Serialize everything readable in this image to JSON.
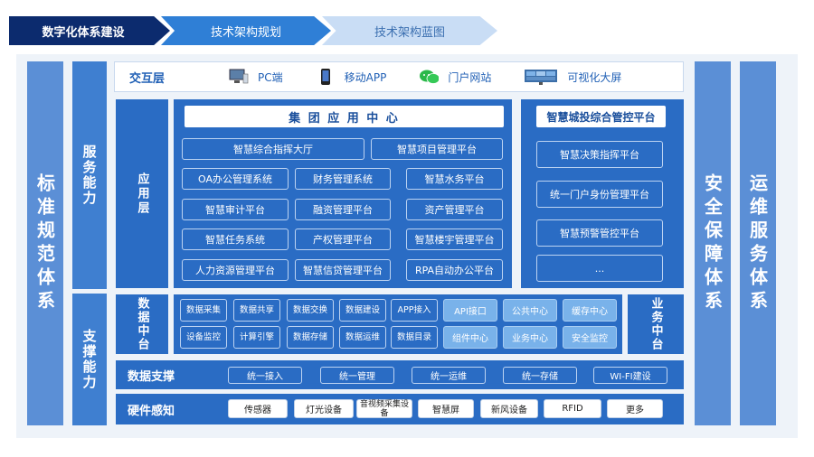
{
  "steps": [
    "数字化体系建设",
    "技术架构规划",
    "技术架构蓝图"
  ],
  "left_columns": {
    "standards": "标准规范体系",
    "service_capability": "服务能力",
    "support_capability": "支撑能力"
  },
  "right_columns": {
    "security": "安全保障体系",
    "ops": "运维服务体系"
  },
  "interaction_layer": {
    "title": "交互层",
    "items": [
      {
        "label": "PC端",
        "icon": "desktop-icon"
      },
      {
        "label": "移动APP",
        "icon": "mobile-phone-icon"
      },
      {
        "label": "门户网站",
        "icon": "wechat-icon"
      },
      {
        "label": "可视化大屏",
        "icon": "big-screen-icon"
      }
    ]
  },
  "application_layer": {
    "title": "应用层",
    "group_center": {
      "title": "集 团 应 用 中 心",
      "rows": [
        [
          "智慧综合指挥大厅",
          "智慧项目管理平台"
        ],
        [
          "OA办公管理系统",
          "财务管理系统",
          "智慧水务平台"
        ],
        [
          "智慧审计平台",
          "融资管理平台",
          "资产管理平台"
        ],
        [
          "智慧任务系统",
          "产权管理平台",
          "智慧楼宇管理平台"
        ],
        [
          "人力资源管理平台",
          "智慧信贷管理平台",
          "RPA自动办公平台"
        ]
      ]
    },
    "city_platform": {
      "title": "智慧城投综合管控平台",
      "items": [
        "智慧决策指挥平台",
        "统一门户身份管理平台",
        "智慧预警管控平台",
        "..."
      ]
    }
  },
  "data_middle": {
    "title": "数据中台",
    "row1": [
      "数据采集",
      "数据共享",
      "数据交换",
      "数据建设",
      "APP接入"
    ],
    "row2": [
      "设备监控",
      "计算引擎",
      "数据存储",
      "数据运维",
      "数据目录"
    ],
    "light_row1": [
      "API接口",
      "公共中心",
      "缓存中心"
    ],
    "light_row2": [
      "组件中心",
      "业务中心",
      "安全监控"
    ]
  },
  "business_middle": {
    "title": "业务中台"
  },
  "data_support": {
    "title": "数据支撑",
    "items": [
      "统一接入",
      "统一管理",
      "统一运维",
      "统一存储",
      "WI-FI建设"
    ]
  },
  "hardware": {
    "title": "硬件感知",
    "items": [
      "传感器",
      "灯光设备",
      "音视频采集设备",
      "智慧屏",
      "新风设备",
      "RFID",
      "更多"
    ]
  },
  "colors": {
    "dark": "#0c2b6e",
    "primary": "#2a6cc4",
    "light": "#79b2ea",
    "column": "#5b8fd6"
  }
}
